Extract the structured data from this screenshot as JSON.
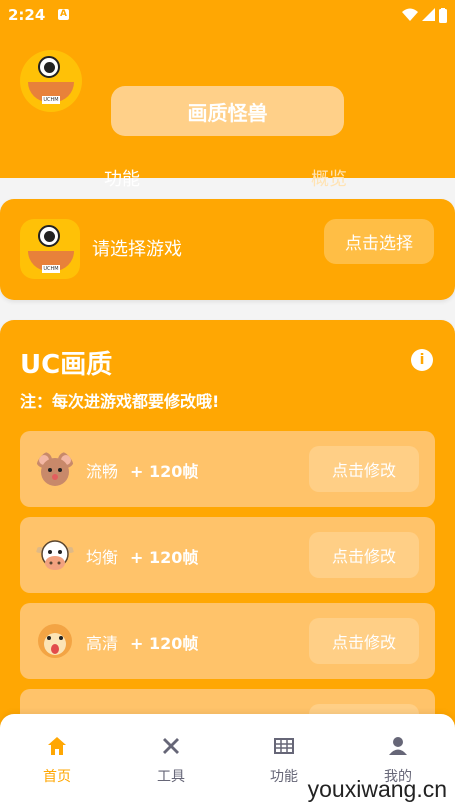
{
  "status_bar": {
    "time": "2:24",
    "indicator": "A"
  },
  "header": {
    "title": "画质怪兽",
    "tabs": [
      "功能",
      "概览"
    ]
  },
  "game_select": {
    "prompt": "请选择游戏",
    "button": "点击选择"
  },
  "uc": {
    "title": "UC画质",
    "note": "注：每次进游戏都要修改哦!",
    "info_icon": "info-icon",
    "rows": [
      {
        "label": "流畅",
        "fps": "+ 120帧",
        "button": "点击修改",
        "icon": "mouse-icon"
      },
      {
        "label": "均衡",
        "fps": "+ 120帧",
        "button": "点击修改",
        "icon": "cow-icon"
      },
      {
        "label": "高清",
        "fps": "+ 120帧",
        "button": "点击修改",
        "icon": "tiger-icon"
      }
    ]
  },
  "bottom_nav": [
    {
      "label": "首页",
      "icon": "home-icon",
      "active": true
    },
    {
      "label": "工具",
      "icon": "tools-icon",
      "active": false
    },
    {
      "label": "功能",
      "icon": "grid-icon",
      "active": false
    },
    {
      "label": "我的",
      "icon": "user-icon",
      "active": false
    }
  ],
  "watermark": "youxiwang.cn",
  "colors": {
    "accent": "#FFA703",
    "background": "#F4F4F4"
  }
}
